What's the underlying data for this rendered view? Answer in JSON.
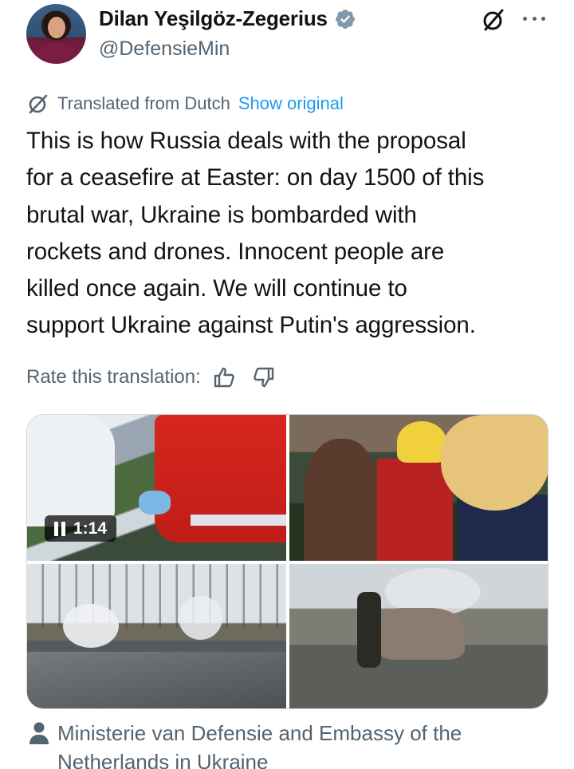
{
  "author": {
    "name": "Dilan Yeşilgöz-Zegerius",
    "handle": "@DefensieMin",
    "verified": true,
    "verified_color": "#829aab"
  },
  "header_actions": {
    "grok_icon": "grok-icon",
    "more_icon": "more-icon"
  },
  "translation": {
    "label": "Translated from Dutch",
    "show_original": "Show original",
    "link_color": "#1d9bf0"
  },
  "tweet": {
    "lines": [
      "This is how Russia deals with the proposal",
      "for a ceasefire at Easter: on day 1500 of this",
      "brutal war, Ukraine is bombarded with",
      "rockets and drones. Innocent people are",
      "killed once again. We will continue to",
      "support Ukraine against Putin's aggression."
    ]
  },
  "rate": {
    "label": "Rate this translation:"
  },
  "media": {
    "video_duration": "1:14",
    "photos": [
      "medical-workers-treating-victim",
      "rescuers-aiding-injured-person",
      "smoke-over-damaged-street",
      "firefighters-at-burnt-car"
    ]
  },
  "mentions": {
    "lines": [
      "Ministerie van Defensie and Embassy of the",
      "Netherlands in Ukraine"
    ]
  }
}
